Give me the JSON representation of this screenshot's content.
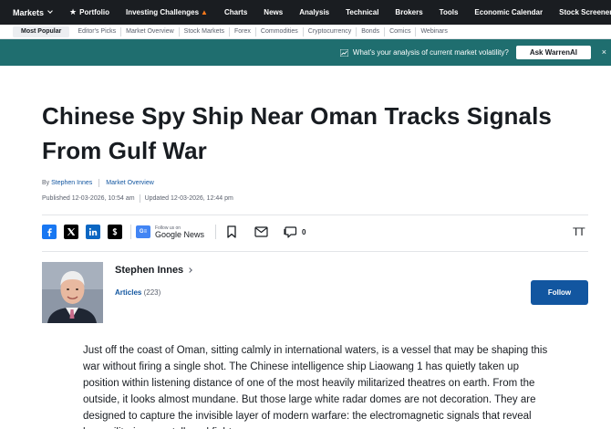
{
  "topnav": {
    "items": [
      "Markets",
      "Portfolio",
      "Investing Challenges",
      "Charts",
      "News",
      "Analysis",
      "Technical",
      "Brokers",
      "Tools",
      "Economic Calendar",
      "Stock Screener"
    ]
  },
  "subnav": {
    "items": [
      "Most Popular",
      "Editor's Picks",
      "Market Overview",
      "Stock Markets",
      "Forex",
      "Commodities",
      "Cryptocurrency",
      "Bonds",
      "Comics",
      "Webinars"
    ]
  },
  "promo": {
    "question": "What's your analysis of current market volatility?",
    "button": "Ask WarrenAI",
    "close": "×"
  },
  "article": {
    "title": "Chinese Spy Ship Near Oman Tracks Signals From Gulf War",
    "by": "By",
    "author_link": "Stephen Innes",
    "category": "Market Overview",
    "published": "Published 12-03-2026, 10:54 am",
    "updated": "Updated 12-03-2026, 12:44 pm",
    "body": "Just off the coast of Oman, sitting calmly in international waters, is a vessel that may be shaping this war without firing a single shot. The Chinese intelligence ship Liaowang 1 has quietly taken up position within listening distance of one of the most heavily militarized theatres on earth. From the outside, it looks almost mundane. But those large white radar domes are not decoration. They are designed to capture the invisible layer of modern warfare: the electromagnetic signals that reveal how militaries see, talk and fight."
  },
  "share": {
    "google_small": "Follow us on",
    "google_big": "Google News",
    "comments": "0",
    "textsize": "TT"
  },
  "author": {
    "name": "Stephen Innes",
    "articles_label": "Articles",
    "articles_count": "(223)",
    "follow": "Follow"
  },
  "colors": {
    "topnav_bg": "#1a1d21",
    "promo_bg": "#1f6e6f",
    "link": "#1256a0",
    "follow_bg": "#1256a0"
  }
}
